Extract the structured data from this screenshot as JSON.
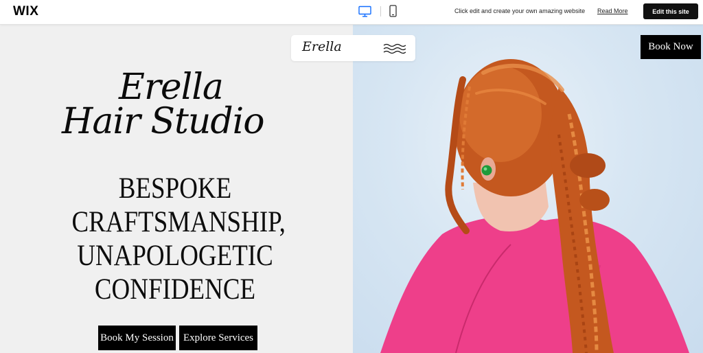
{
  "wix_bar": {
    "logo": "WIX",
    "promo_text": "Click edit and create your own amazing website",
    "read_more": "Read More",
    "edit_button": "Edit this site",
    "accent_color": "#116dff"
  },
  "site_header": {
    "logo": "Erella",
    "book_now": "Book Now"
  },
  "hero": {
    "title_line1": "Erella",
    "title_line2": "Hair Studio",
    "tagline": [
      "BESPOKE",
      "CRAFTSMANSHIP,",
      "UNAPOLOGETIC",
      "CONFIDENCE"
    ],
    "primary_button": "Book My Session",
    "secondary_button": "Explore Services"
  },
  "icons": {
    "desktop": "desktop-icon",
    "mobile": "mobile-icon",
    "menu": "wavy-menu-icon"
  },
  "colors": {
    "page_bg": "#f0f0f0",
    "button_bg": "#000000",
    "photo_bg": "#d7e6f3",
    "cape": "#ee3f8a",
    "hair": "#c55b22"
  }
}
